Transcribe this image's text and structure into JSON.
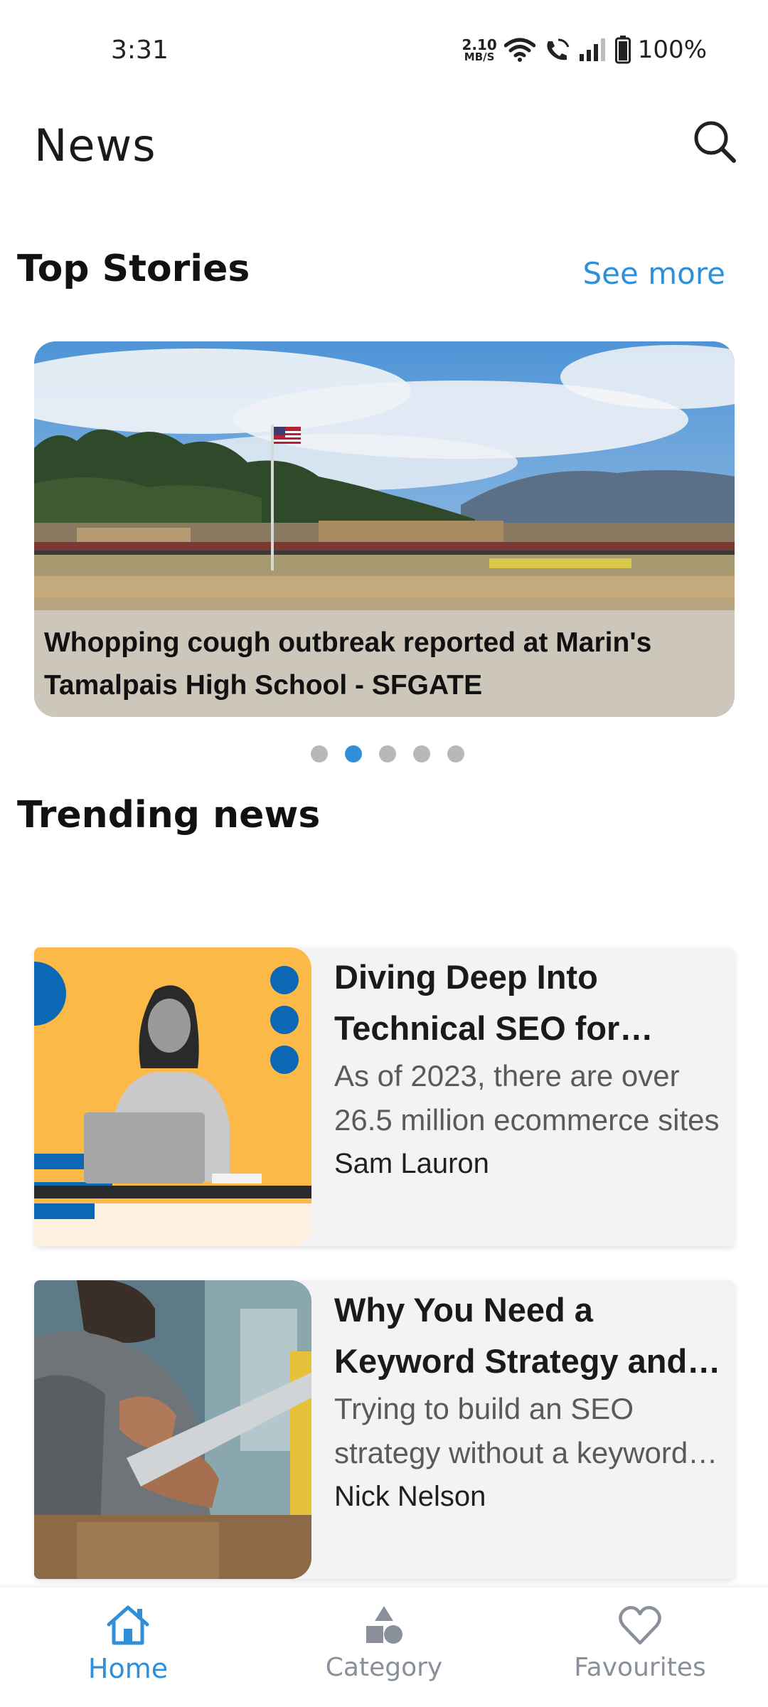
{
  "status_bar": {
    "time": "3:31",
    "net_speed_value": "2.10",
    "net_speed_unit": "MB/S",
    "battery": "100%"
  },
  "app_bar": {
    "title": "News",
    "search_icon": "search-icon"
  },
  "top_stories": {
    "title": "Top Stories",
    "see_more": "See more",
    "slide": {
      "caption_line1": "Whopping cough outbreak reported at Marin's",
      "caption_line2": "Tamalpais High School - SFGATE"
    },
    "dots_count": 5,
    "active_dot": 2
  },
  "trending": {
    "title": "Trending news",
    "items": [
      {
        "title": "Diving Deep Into Technical SEO for Ecommerce",
        "description": "As of 2023, there are over 26.5 million ecommerce sites",
        "author": "Sam Lauron"
      },
      {
        "title": "Why You Need a Keyword Strategy and How to Build One",
        "description": "Trying to build an SEO strategy without a keyword strategy",
        "author": "Nick Nelson"
      }
    ]
  },
  "bottom_nav": {
    "items": [
      {
        "label": "Home",
        "icon": "home-icon",
        "active": true
      },
      {
        "label": "Category",
        "icon": "category-icon",
        "active": false
      },
      {
        "label": "Favourites",
        "icon": "heart-icon",
        "active": false
      }
    ]
  },
  "colors": {
    "accent": "#2f8fd8",
    "inactive": "#8a9099",
    "card_bg": "#f3f3f3"
  }
}
